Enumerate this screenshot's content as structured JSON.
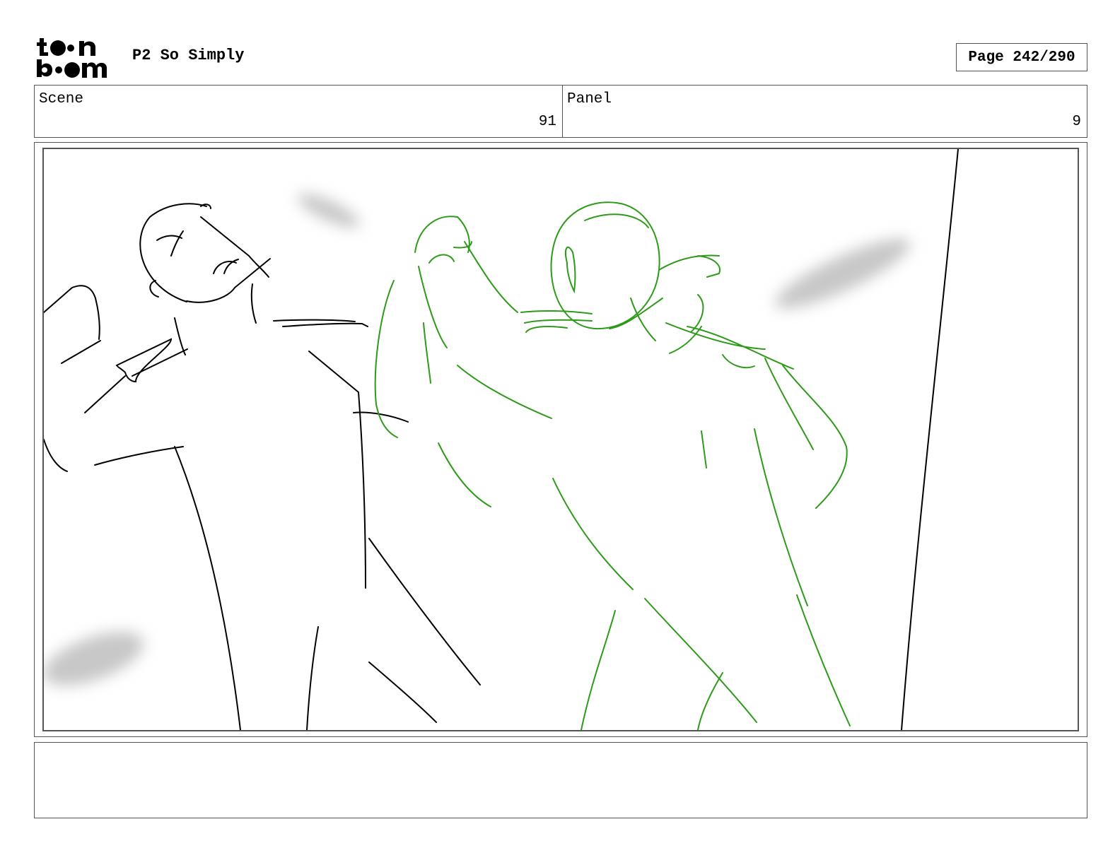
{
  "header": {
    "logo_text": "toon boom",
    "project_title": "P2 So Simply",
    "page_label": "Page 242/290"
  },
  "info": {
    "scene_label": "Scene",
    "scene_value": "91",
    "panel_label": "Panel",
    "panel_value": "9"
  },
  "sketch": {
    "line_color": "#000000",
    "figure_color": "#2e9a1a",
    "smudge_color": "#c8c8c8"
  },
  "notes": {
    "text": ""
  }
}
